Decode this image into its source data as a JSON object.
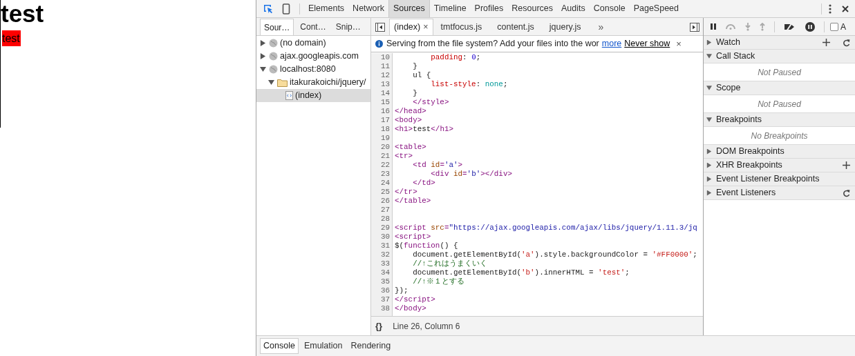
{
  "page": {
    "heading": "test",
    "cell_text": "test"
  },
  "toolbar": {
    "tabs": [
      {
        "label": "Elements",
        "selected": false
      },
      {
        "label": "Network",
        "selected": false
      },
      {
        "label": "Sources",
        "selected": true
      },
      {
        "label": "Timeline",
        "selected": false
      },
      {
        "label": "Profiles",
        "selected": false
      },
      {
        "label": "Resources",
        "selected": false
      },
      {
        "label": "Audits",
        "selected": false
      },
      {
        "label": "Console",
        "selected": false
      },
      {
        "label": "PageSpeed",
        "selected": false
      }
    ]
  },
  "navigator": {
    "tabs": [
      {
        "label": "Sour…",
        "selected": true
      },
      {
        "label": "Cont…",
        "selected": false
      },
      {
        "label": "Snip…",
        "selected": false
      }
    ],
    "tree": [
      {
        "label": "(no domain)",
        "kind": "domain",
        "expanded": false,
        "selected": false
      },
      {
        "label": "ajax.googleapis.com",
        "kind": "domain",
        "expanded": false,
        "selected": false
      },
      {
        "label": "localhost:8080",
        "kind": "domain",
        "expanded": true,
        "selected": false,
        "children": [
          {
            "label": "itakurakoichi/jquery/",
            "kind": "folder",
            "expanded": true,
            "selected": false,
            "children": [
              {
                "label": "(index)",
                "kind": "file",
                "selected": true
              }
            ]
          }
        ]
      }
    ]
  },
  "editor": {
    "tabs": [
      {
        "label": "(index)",
        "selected": true,
        "close": "×"
      },
      {
        "label": "tmtfocus.js",
        "selected": false
      },
      {
        "label": "content.js",
        "selected": false
      },
      {
        "label": "jquery.js",
        "selected": false
      }
    ],
    "overflow": "»",
    "infobar": {
      "message": "Serving from the file system? Add your files into the wor",
      "link": "more",
      "dismiss": "Never show",
      "close": "×"
    },
    "lines": [
      {
        "number": "10",
        "tokens": [
          {
            "kind": "cssprop",
            "text": "        padding"
          },
          {
            "kind": "plain",
            "text": ": "
          },
          {
            "kind": "number",
            "text": "0"
          },
          {
            "kind": "plain",
            "text": ";"
          }
        ]
      },
      {
        "number": "11",
        "tokens": [
          {
            "kind": "plain",
            "text": "    }"
          }
        ]
      },
      {
        "number": "12",
        "tokens": [
          {
            "kind": "plain",
            "text": "    ul {"
          }
        ]
      },
      {
        "number": "13",
        "tokens": [
          {
            "kind": "cssprop",
            "text": "        list-style"
          },
          {
            "kind": "plain",
            "text": ": "
          },
          {
            "kind": "cssvalue",
            "text": "none"
          },
          {
            "kind": "plain",
            "text": ";"
          }
        ]
      },
      {
        "number": "14",
        "tokens": [
          {
            "kind": "plain",
            "text": "    }"
          }
        ]
      },
      {
        "number": "15",
        "tokens": [
          {
            "kind": "tag",
            "text": "    </style>"
          }
        ]
      },
      {
        "number": "16",
        "tokens": [
          {
            "kind": "tag",
            "text": "</head>"
          }
        ]
      },
      {
        "number": "17",
        "tokens": [
          {
            "kind": "tag",
            "text": "<body>"
          }
        ]
      },
      {
        "number": "18",
        "tokens": [
          {
            "kind": "tag",
            "text": "<h1>"
          },
          {
            "kind": "plain",
            "text": "test"
          },
          {
            "kind": "tag",
            "text": "</h1>"
          }
        ]
      },
      {
        "number": "19"
      },
      {
        "number": "20",
        "tokens": [
          {
            "kind": "tag",
            "text": "<table>"
          }
        ]
      },
      {
        "number": "21",
        "tokens": [
          {
            "kind": "tag",
            "text": "<tr>"
          }
        ]
      },
      {
        "number": "22",
        "tokens": [
          {
            "kind": "tag",
            "text": "    <td "
          },
          {
            "kind": "attr",
            "text": "id"
          },
          {
            "kind": "tag",
            "text": "="
          },
          {
            "kind": "attrvalue",
            "text": "'a'"
          },
          {
            "kind": "tag",
            "text": ">"
          }
        ]
      },
      {
        "number": "23",
        "tokens": [
          {
            "kind": "tag",
            "text": "        <div "
          },
          {
            "kind": "attr",
            "text": "id"
          },
          {
            "kind": "tag",
            "text": "="
          },
          {
            "kind": "attrvalue",
            "text": "'b'"
          },
          {
            "kind": "tag",
            "text": "></div>"
          }
        ]
      },
      {
        "number": "24",
        "tokens": [
          {
            "kind": "tag",
            "text": "    </td>"
          }
        ]
      },
      {
        "number": "25",
        "tokens": [
          {
            "kind": "tag",
            "text": "</tr>"
          }
        ]
      },
      {
        "number": "26",
        "tokens": [
          {
            "kind": "tag",
            "text": "</table>"
          }
        ]
      },
      {
        "number": "27"
      },
      {
        "number": "28"
      },
      {
        "number": "29",
        "tokens": [
          {
            "kind": "tag",
            "text": "<script "
          },
          {
            "kind": "attr",
            "text": "src"
          },
          {
            "kind": "tag",
            "text": "="
          },
          {
            "kind": "attrvalue",
            "text": "\"https://ajax.googleapis.com/ajax/libs/jquery/1.11.3/jq"
          }
        ]
      },
      {
        "number": "30",
        "tokens": [
          {
            "kind": "tag",
            "text": "<script>"
          }
        ]
      },
      {
        "number": "31",
        "tokens": [
          {
            "kind": "plain",
            "text": "$("
          },
          {
            "kind": "keyword",
            "text": "function"
          },
          {
            "kind": "plain",
            "text": "() {"
          }
        ]
      },
      {
        "number": "32",
        "tokens": [
          {
            "kind": "plain",
            "text": "    document.getElementById("
          },
          {
            "kind": "string",
            "text": "'a'"
          },
          {
            "kind": "plain",
            "text": ").style.backgroundColor = "
          },
          {
            "kind": "string",
            "text": "'#FF0000'"
          },
          {
            "kind": "plain",
            "text": ";"
          }
        ]
      },
      {
        "number": "33",
        "tokens": [
          {
            "kind": "comment",
            "text": "    //↑これはうまくいく"
          }
        ]
      },
      {
        "number": "34",
        "tokens": [
          {
            "kind": "plain",
            "text": "    document.getElementById("
          },
          {
            "kind": "string",
            "text": "'b'"
          },
          {
            "kind": "plain",
            "text": ").innerHTML = "
          },
          {
            "kind": "string",
            "text": "'test'"
          },
          {
            "kind": "plain",
            "text": ";"
          }
        ]
      },
      {
        "number": "35",
        "tokens": [
          {
            "kind": "comment",
            "text": "    //↑※１とする"
          }
        ]
      },
      {
        "number": "36",
        "tokens": [
          {
            "kind": "plain",
            "text": "});"
          }
        ]
      },
      {
        "number": "37",
        "tokens": [
          {
            "kind": "tag",
            "text": "</script>"
          }
        ]
      },
      {
        "number": "38",
        "tokens": [
          {
            "kind": "tag",
            "text": "</body>"
          }
        ]
      }
    ],
    "status": {
      "pretty_print": "{}",
      "position": "Line 26, Column 6"
    }
  },
  "debugger": {
    "async_label": "A",
    "async_checked": false,
    "sections": [
      {
        "title": "Watch",
        "expanded": false,
        "add_button": true,
        "refresh_button": true
      },
      {
        "title": "Call Stack",
        "expanded": true,
        "placeholder": "Not Paused"
      },
      {
        "title": "Scope",
        "expanded": true,
        "placeholder": "Not Paused"
      },
      {
        "title": "Breakpoints",
        "expanded": true,
        "placeholder": "No Breakpoints"
      },
      {
        "title": "DOM Breakpoints",
        "expanded": false
      },
      {
        "title": "XHR Breakpoints",
        "expanded": false,
        "add_button": true
      },
      {
        "title": "Event Listener Breakpoints",
        "expanded": false
      },
      {
        "title": "Event Listeners",
        "expanded": false,
        "refresh_button": true
      }
    ]
  },
  "drawer": {
    "tabs": [
      {
        "label": "Console",
        "selected": true
      },
      {
        "label": "Emulation",
        "selected": false
      },
      {
        "label": "Rendering",
        "selected": false
      }
    ]
  }
}
